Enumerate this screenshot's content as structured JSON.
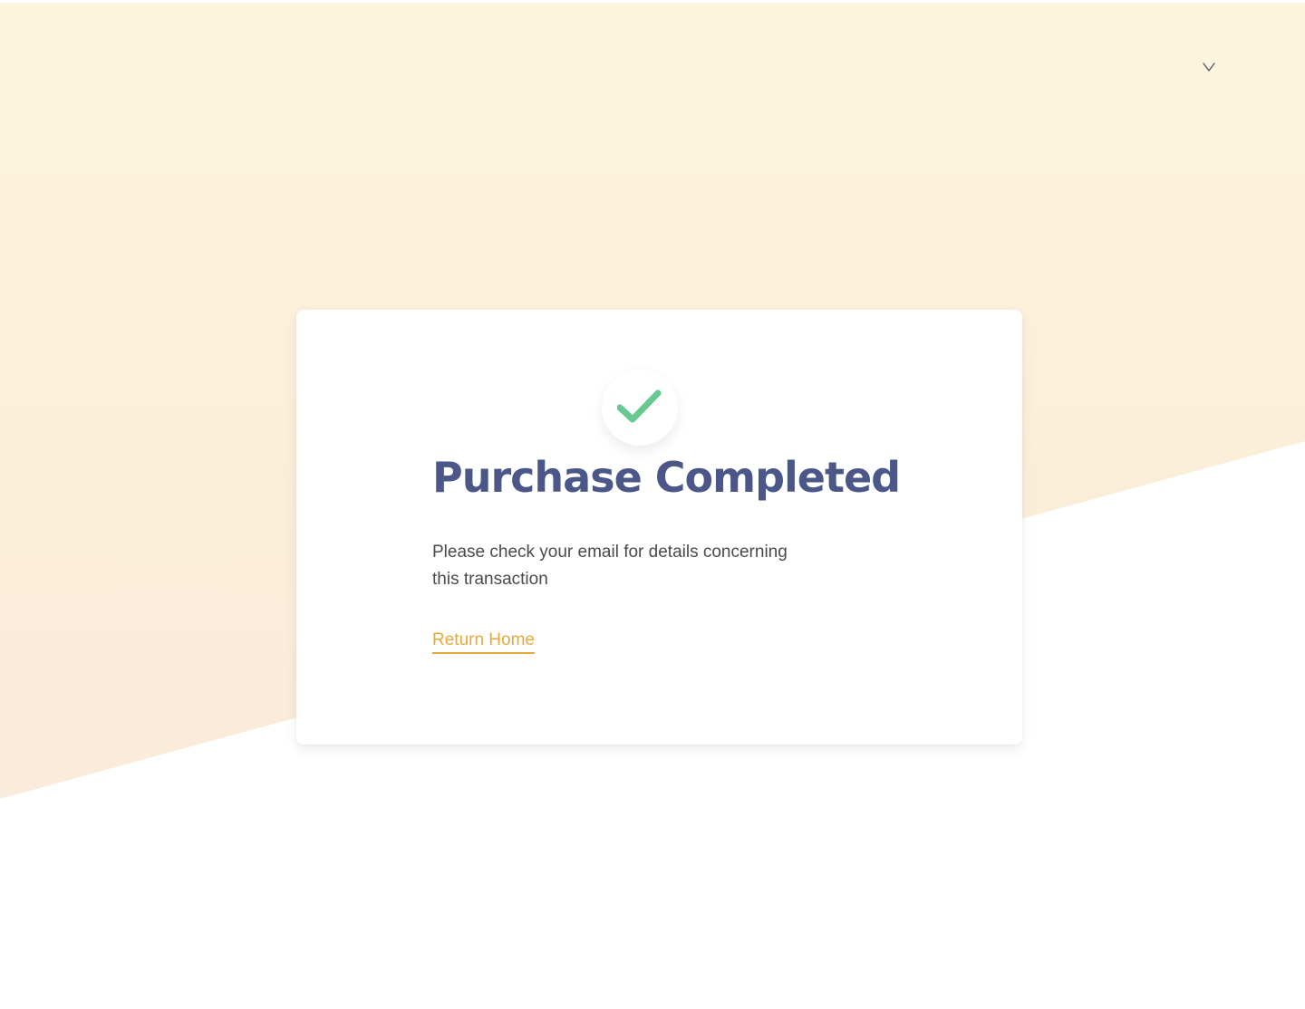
{
  "header": {
    "menu_icon": "chevron-down-icon"
  },
  "confirmation": {
    "icon": "checkmark-icon",
    "title": "Purchase Completed",
    "message": "Please check your email for details concerning this transaction",
    "return_link_label": "Return Home"
  },
  "colors": {
    "background_top": "#fcf5dd",
    "background_bottom": "#fbe9dc",
    "title": "#4b5689",
    "check": "#66c98f",
    "link": "#e9a93a",
    "text": "#4a4a4a"
  }
}
